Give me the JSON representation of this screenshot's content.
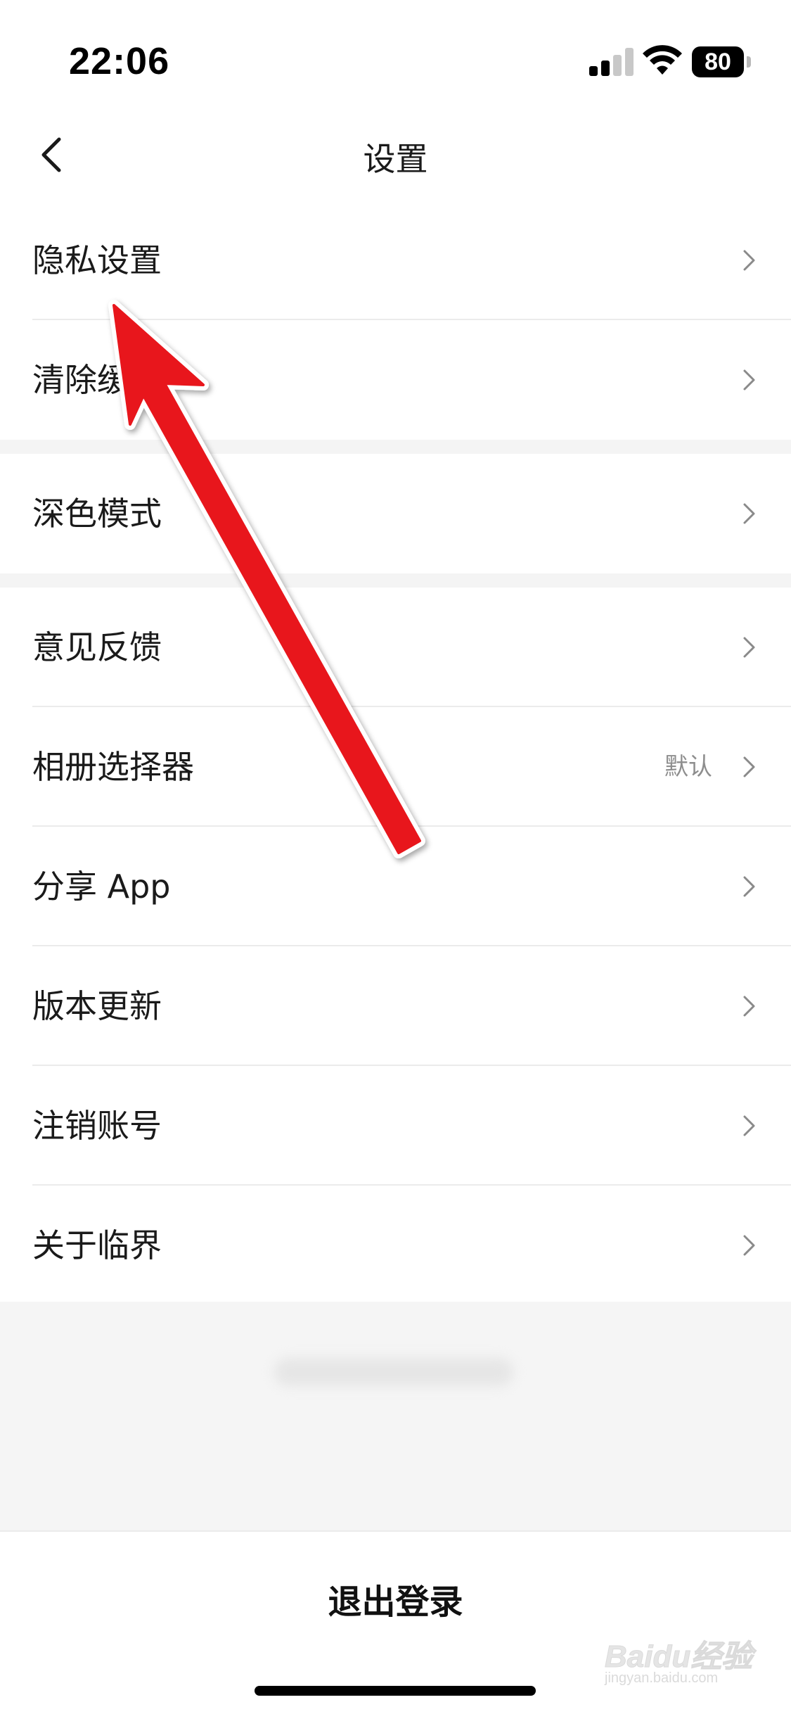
{
  "status_bar": {
    "time": "22:06",
    "battery": "80",
    "icons": [
      "cellular-signal-icon",
      "wifi-icon",
      "battery-icon"
    ]
  },
  "nav": {
    "title": "设置",
    "back_icon": "chevron-left-icon"
  },
  "groups": [
    {
      "items": [
        {
          "label": "隐私设置",
          "value": "",
          "icon": "chevron-right-icon"
        },
        {
          "label": "清除缓存",
          "value": "",
          "icon": "chevron-right-icon"
        }
      ]
    },
    {
      "items": [
        {
          "label": "深色模式",
          "value": "",
          "icon": "chevron-right-icon"
        }
      ]
    },
    {
      "items": [
        {
          "label": "意见反馈",
          "value": "",
          "icon": "chevron-right-icon"
        },
        {
          "label": "相册选择器",
          "value": "默认",
          "icon": "chevron-right-icon"
        },
        {
          "label": "分享 App",
          "value": "",
          "icon": "chevron-right-icon"
        },
        {
          "label": "版本更新",
          "value": "",
          "icon": "chevron-right-icon"
        },
        {
          "label": "注销账号",
          "value": "",
          "icon": "chevron-right-icon"
        },
        {
          "label": "关于临界",
          "value": "",
          "icon": "chevron-right-icon"
        }
      ]
    }
  ],
  "logout": {
    "label": "退出登录"
  },
  "watermark": {
    "logo": "Baidu经验",
    "url": "jingyan.baidu.com"
  },
  "annotation": {
    "color": "#e8141b",
    "icon": "red-arrow-pointer"
  }
}
